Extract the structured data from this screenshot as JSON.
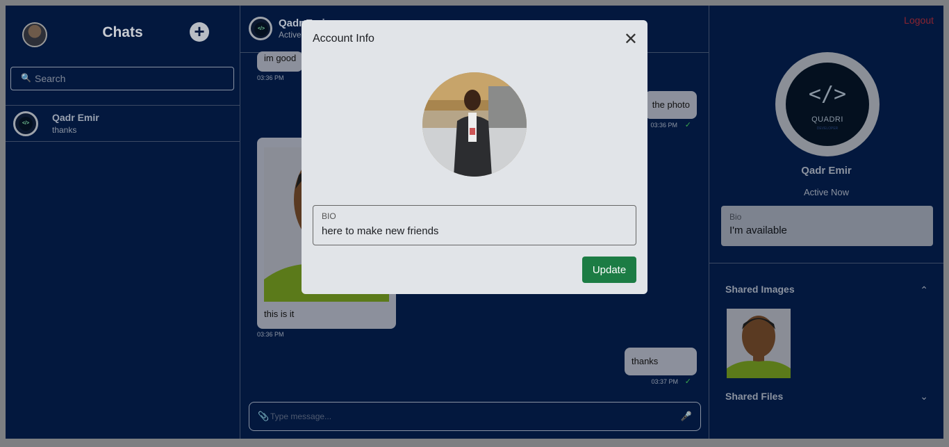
{
  "sidebar": {
    "title": "Chats",
    "search_placeholder": "Search",
    "contacts": [
      {
        "name": "Qadr Emir",
        "last_message": "thanks"
      }
    ]
  },
  "chat": {
    "header": {
      "name": "Qadr Emir",
      "status": "Active"
    },
    "messages": [
      {
        "text": "im good",
        "time": "03:36 PM",
        "direction": "in"
      },
      {
        "text": "the photo",
        "time": "03:36 PM",
        "direction": "out",
        "read": true
      },
      {
        "text": "this is it",
        "time": "03:36 PM",
        "direction": "in",
        "has_image": true
      },
      {
        "text": "thanks",
        "time": "03:37 PM",
        "direction": "out",
        "read": true
      }
    ],
    "composer_placeholder": "Type message..."
  },
  "profile": {
    "logout_label": "Logout",
    "name": "Qadr Emir",
    "status": "Active Now",
    "brand_text": "QUADRI",
    "brand_sub": "DEVELOPER",
    "bio_label": "Bio",
    "bio_value": "I'm available",
    "shared_images_label": "Shared Images",
    "shared_files_label": "Shared Files"
  },
  "modal": {
    "title": "Account Info",
    "bio_label": "BIO",
    "bio_value": "here to make new friends",
    "update_label": "Update"
  },
  "icons": {
    "add": "plus-icon",
    "search": "search-icon",
    "close": "close-icon",
    "attach": "paperclip-icon",
    "mic": "microphone-icon",
    "read": "check-icon",
    "expand": "chevron-down-icon",
    "collapse": "chevron-up-icon"
  },
  "colors": {
    "background": "#03183e",
    "accent_green": "#1c7c44",
    "logout_red": "#8b2430"
  }
}
